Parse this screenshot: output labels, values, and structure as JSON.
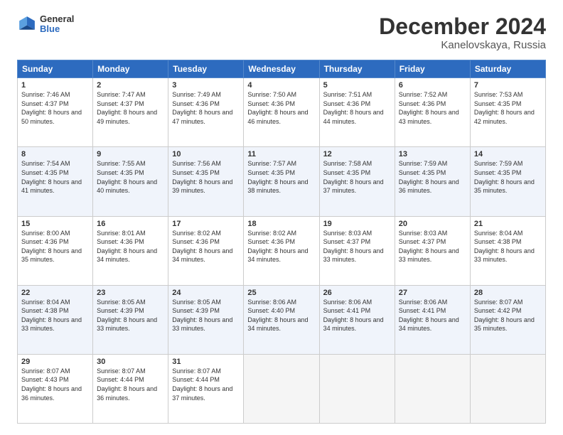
{
  "header": {
    "logo_general": "General",
    "logo_blue": "Blue",
    "title": "December 2024",
    "subtitle": "Kanelovskaya, Russia"
  },
  "columns": [
    "Sunday",
    "Monday",
    "Tuesday",
    "Wednesday",
    "Thursday",
    "Friday",
    "Saturday"
  ],
  "weeks": [
    [
      {
        "day": "1",
        "sunrise": "Sunrise: 7:46 AM",
        "sunset": "Sunset: 4:37 PM",
        "daylight": "Daylight: 8 hours and 50 minutes."
      },
      {
        "day": "2",
        "sunrise": "Sunrise: 7:47 AM",
        "sunset": "Sunset: 4:37 PM",
        "daylight": "Daylight: 8 hours and 49 minutes."
      },
      {
        "day": "3",
        "sunrise": "Sunrise: 7:49 AM",
        "sunset": "Sunset: 4:36 PM",
        "daylight": "Daylight: 8 hours and 47 minutes."
      },
      {
        "day": "4",
        "sunrise": "Sunrise: 7:50 AM",
        "sunset": "Sunset: 4:36 PM",
        "daylight": "Daylight: 8 hours and 46 minutes."
      },
      {
        "day": "5",
        "sunrise": "Sunrise: 7:51 AM",
        "sunset": "Sunset: 4:36 PM",
        "daylight": "Daylight: 8 hours and 44 minutes."
      },
      {
        "day": "6",
        "sunrise": "Sunrise: 7:52 AM",
        "sunset": "Sunset: 4:36 PM",
        "daylight": "Daylight: 8 hours and 43 minutes."
      },
      {
        "day": "7",
        "sunrise": "Sunrise: 7:53 AM",
        "sunset": "Sunset: 4:35 PM",
        "daylight": "Daylight: 8 hours and 42 minutes."
      }
    ],
    [
      {
        "day": "8",
        "sunrise": "Sunrise: 7:54 AM",
        "sunset": "Sunset: 4:35 PM",
        "daylight": "Daylight: 8 hours and 41 minutes."
      },
      {
        "day": "9",
        "sunrise": "Sunrise: 7:55 AM",
        "sunset": "Sunset: 4:35 PM",
        "daylight": "Daylight: 8 hours and 40 minutes."
      },
      {
        "day": "10",
        "sunrise": "Sunrise: 7:56 AM",
        "sunset": "Sunset: 4:35 PM",
        "daylight": "Daylight: 8 hours and 39 minutes."
      },
      {
        "day": "11",
        "sunrise": "Sunrise: 7:57 AM",
        "sunset": "Sunset: 4:35 PM",
        "daylight": "Daylight: 8 hours and 38 minutes."
      },
      {
        "day": "12",
        "sunrise": "Sunrise: 7:58 AM",
        "sunset": "Sunset: 4:35 PM",
        "daylight": "Daylight: 8 hours and 37 minutes."
      },
      {
        "day": "13",
        "sunrise": "Sunrise: 7:59 AM",
        "sunset": "Sunset: 4:35 PM",
        "daylight": "Daylight: 8 hours and 36 minutes."
      },
      {
        "day": "14",
        "sunrise": "Sunrise: 7:59 AM",
        "sunset": "Sunset: 4:35 PM",
        "daylight": "Daylight: 8 hours and 35 minutes."
      }
    ],
    [
      {
        "day": "15",
        "sunrise": "Sunrise: 8:00 AM",
        "sunset": "Sunset: 4:36 PM",
        "daylight": "Daylight: 8 hours and 35 minutes."
      },
      {
        "day": "16",
        "sunrise": "Sunrise: 8:01 AM",
        "sunset": "Sunset: 4:36 PM",
        "daylight": "Daylight: 8 hours and 34 minutes."
      },
      {
        "day": "17",
        "sunrise": "Sunrise: 8:02 AM",
        "sunset": "Sunset: 4:36 PM",
        "daylight": "Daylight: 8 hours and 34 minutes."
      },
      {
        "day": "18",
        "sunrise": "Sunrise: 8:02 AM",
        "sunset": "Sunset: 4:36 PM",
        "daylight": "Daylight: 8 hours and 34 minutes."
      },
      {
        "day": "19",
        "sunrise": "Sunrise: 8:03 AM",
        "sunset": "Sunset: 4:37 PM",
        "daylight": "Daylight: 8 hours and 33 minutes."
      },
      {
        "day": "20",
        "sunrise": "Sunrise: 8:03 AM",
        "sunset": "Sunset: 4:37 PM",
        "daylight": "Daylight: 8 hours and 33 minutes."
      },
      {
        "day": "21",
        "sunrise": "Sunrise: 8:04 AM",
        "sunset": "Sunset: 4:38 PM",
        "daylight": "Daylight: 8 hours and 33 minutes."
      }
    ],
    [
      {
        "day": "22",
        "sunrise": "Sunrise: 8:04 AM",
        "sunset": "Sunset: 4:38 PM",
        "daylight": "Daylight: 8 hours and 33 minutes."
      },
      {
        "day": "23",
        "sunrise": "Sunrise: 8:05 AM",
        "sunset": "Sunset: 4:39 PM",
        "daylight": "Daylight: 8 hours and 33 minutes."
      },
      {
        "day": "24",
        "sunrise": "Sunrise: 8:05 AM",
        "sunset": "Sunset: 4:39 PM",
        "daylight": "Daylight: 8 hours and 33 minutes."
      },
      {
        "day": "25",
        "sunrise": "Sunrise: 8:06 AM",
        "sunset": "Sunset: 4:40 PM",
        "daylight": "Daylight: 8 hours and 34 minutes."
      },
      {
        "day": "26",
        "sunrise": "Sunrise: 8:06 AM",
        "sunset": "Sunset: 4:41 PM",
        "daylight": "Daylight: 8 hours and 34 minutes."
      },
      {
        "day": "27",
        "sunrise": "Sunrise: 8:06 AM",
        "sunset": "Sunset: 4:41 PM",
        "daylight": "Daylight: 8 hours and 34 minutes."
      },
      {
        "day": "28",
        "sunrise": "Sunrise: 8:07 AM",
        "sunset": "Sunset: 4:42 PM",
        "daylight": "Daylight: 8 hours and 35 minutes."
      }
    ],
    [
      {
        "day": "29",
        "sunrise": "Sunrise: 8:07 AM",
        "sunset": "Sunset: 4:43 PM",
        "daylight": "Daylight: 8 hours and 36 minutes."
      },
      {
        "day": "30",
        "sunrise": "Sunrise: 8:07 AM",
        "sunset": "Sunset: 4:44 PM",
        "daylight": "Daylight: 8 hours and 36 minutes."
      },
      {
        "day": "31",
        "sunrise": "Sunrise: 8:07 AM",
        "sunset": "Sunset: 4:44 PM",
        "daylight": "Daylight: 8 hours and 37 minutes."
      },
      null,
      null,
      null,
      null
    ]
  ]
}
